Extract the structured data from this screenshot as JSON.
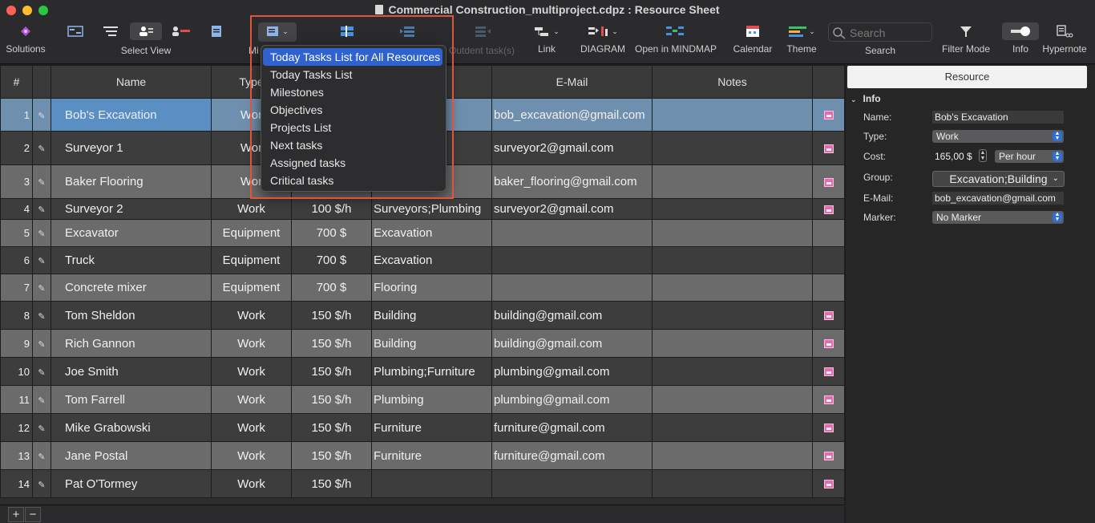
{
  "window": {
    "title": "Commercial Construction_multiproject.cdpz : Resource Sheet"
  },
  "toolbar": {
    "solutions_label": "Solutions",
    "select_view_label": "Select View",
    "mindmap_partial_label": "Mi",
    "outdent_label": "Outdent task(s)",
    "link_label": "Link",
    "diagram_label": "DIAGRAM",
    "open_mindmap_label": "Open in MINDMAP",
    "calendar_label": "Calendar",
    "theme_label": "Theme",
    "search_label": "Search",
    "search_placeholder": "Search",
    "filter_label": "Filter Mode",
    "info_label": "Info",
    "hypernote_label": "Hypernote"
  },
  "colors": {
    "accent_blue": "#2f62cc",
    "highlight_red": "#e0533c",
    "solutions_purple": "#b04fe0",
    "calendar_pink": "#e66bb3"
  },
  "table": {
    "headers": {
      "num": "#",
      "name": "Name",
      "type": "Type",
      "email": "E-Mail",
      "notes": "Notes"
    },
    "rows": [
      {
        "num": "1",
        "name": "Bob's Excavation",
        "type": "Wor",
        "cost": "",
        "group": "lding",
        "email": "bob_excavation@gmail.com",
        "cal": true
      },
      {
        "num": "2",
        "name": "Surveyor 1",
        "type": "Wor",
        "cost": "",
        "group": "ding",
        "email": "surveyor2@gmail.com",
        "cal": true
      },
      {
        "num": "3",
        "name": "Baker Flooring",
        "type": "Wor",
        "cost": "",
        "group": "",
        "email": "baker_flooring@gmail.com",
        "cal": true
      },
      {
        "num": "4",
        "name": "Surveyor 2",
        "type": "Work",
        "cost": "100 $/h",
        "group": "Surveyors;Plumbing",
        "email": "surveyor2@gmail.com",
        "cal": true
      },
      {
        "num": "5",
        "name": "Excavator",
        "type": "Equipment",
        "cost": "700 $",
        "group": "Excavation",
        "email": "",
        "cal": false
      },
      {
        "num": "6",
        "name": "Truck",
        "type": "Equipment",
        "cost": "700 $",
        "group": "Excavation",
        "email": "",
        "cal": false
      },
      {
        "num": "7",
        "name": "Concrete mixer",
        "type": "Equipment",
        "cost": "700 $",
        "group": "Flooring",
        "email": "",
        "cal": false
      },
      {
        "num": "8",
        "name": "Tom Sheldon",
        "type": "Work",
        "cost": "150 $/h",
        "group": "Building",
        "email": "building@gmail.com",
        "cal": true
      },
      {
        "num": "9",
        "name": "Rich Gannon",
        "type": "Work",
        "cost": "150 $/h",
        "group": "Building",
        "email": "building@gmail.com",
        "cal": true
      },
      {
        "num": "10",
        "name": "Joe Smith",
        "type": "Work",
        "cost": "150 $/h",
        "group": "Plumbing;Furniture",
        "email": "plumbing@gmail.com",
        "cal": true
      },
      {
        "num": "11",
        "name": "Tom Farrell",
        "type": "Work",
        "cost": "150 $/h",
        "group": "Plumbing",
        "email": "plumbing@gmail.com",
        "cal": true
      },
      {
        "num": "12",
        "name": "Mike Grabowski",
        "type": "Work",
        "cost": "150 $/h",
        "group": "Furniture",
        "email": "furniture@gmail.com",
        "cal": true
      },
      {
        "num": "13",
        "name": "Jane Postal",
        "type": "Work",
        "cost": "150 $/h",
        "group": "Furniture",
        "email": "furniture@gmail.com",
        "cal": true
      },
      {
        "num": "14",
        "name": "Pat O'Tormey",
        "type": "Work",
        "cost": "150 $/h",
        "group": "",
        "email": "",
        "cal": true
      }
    ]
  },
  "bottom": {
    "add": "+",
    "remove": "−"
  },
  "inspector": {
    "tab": "Resource",
    "section": "Info",
    "name_label": "Name:",
    "name_value": "Bob's Excavation",
    "type_label": "Type:",
    "type_value": "Work",
    "cost_label": "Cost:",
    "cost_value": "165,00 $",
    "cost_unit": "Per hour",
    "group_label": "Group:",
    "group_value": "Excavation;Building",
    "email_label": "E-Mail:",
    "email_value": "bob_excavation@gmail.com",
    "marker_label": "Marker:",
    "marker_value": "No Marker"
  },
  "menu": {
    "items": [
      "Today Tasks List for All Resources",
      "Today Tasks List",
      "Milestones",
      "Objectives",
      "Projects List",
      "Next tasks",
      "Assigned tasks",
      "Critical tasks"
    ]
  }
}
